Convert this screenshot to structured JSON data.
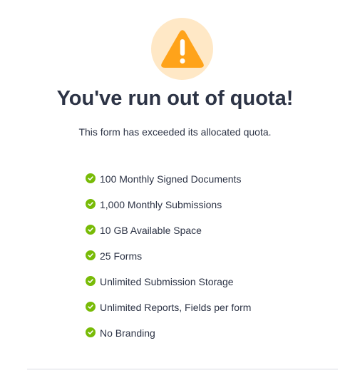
{
  "icon": {
    "name": "warning-icon",
    "circle_color": "#ffe8c6",
    "triangle_color": "#ffa31a"
  },
  "title": "You've run out of quota!",
  "subtitle": "This form has exceeded its allocated quota.",
  "features": [
    {
      "label": "100 Monthly Signed Documents",
      "icon": "check-circle-icon"
    },
    {
      "label": "1,000 Monthly Submissions",
      "icon": "check-circle-icon"
    },
    {
      "label": "10 GB Available Space",
      "icon": "check-circle-icon"
    },
    {
      "label": "25 Forms",
      "icon": "check-circle-icon"
    },
    {
      "label": "Unlimited Submission Storage",
      "icon": "check-circle-icon"
    },
    {
      "label": "Unlimited Reports, Fields per form",
      "icon": "check-circle-icon"
    },
    {
      "label": "No Branding",
      "icon": "check-circle-icon"
    }
  ],
  "colors": {
    "text": "#2c3345",
    "check": "#78bb07",
    "divider": "#d8dae3"
  }
}
